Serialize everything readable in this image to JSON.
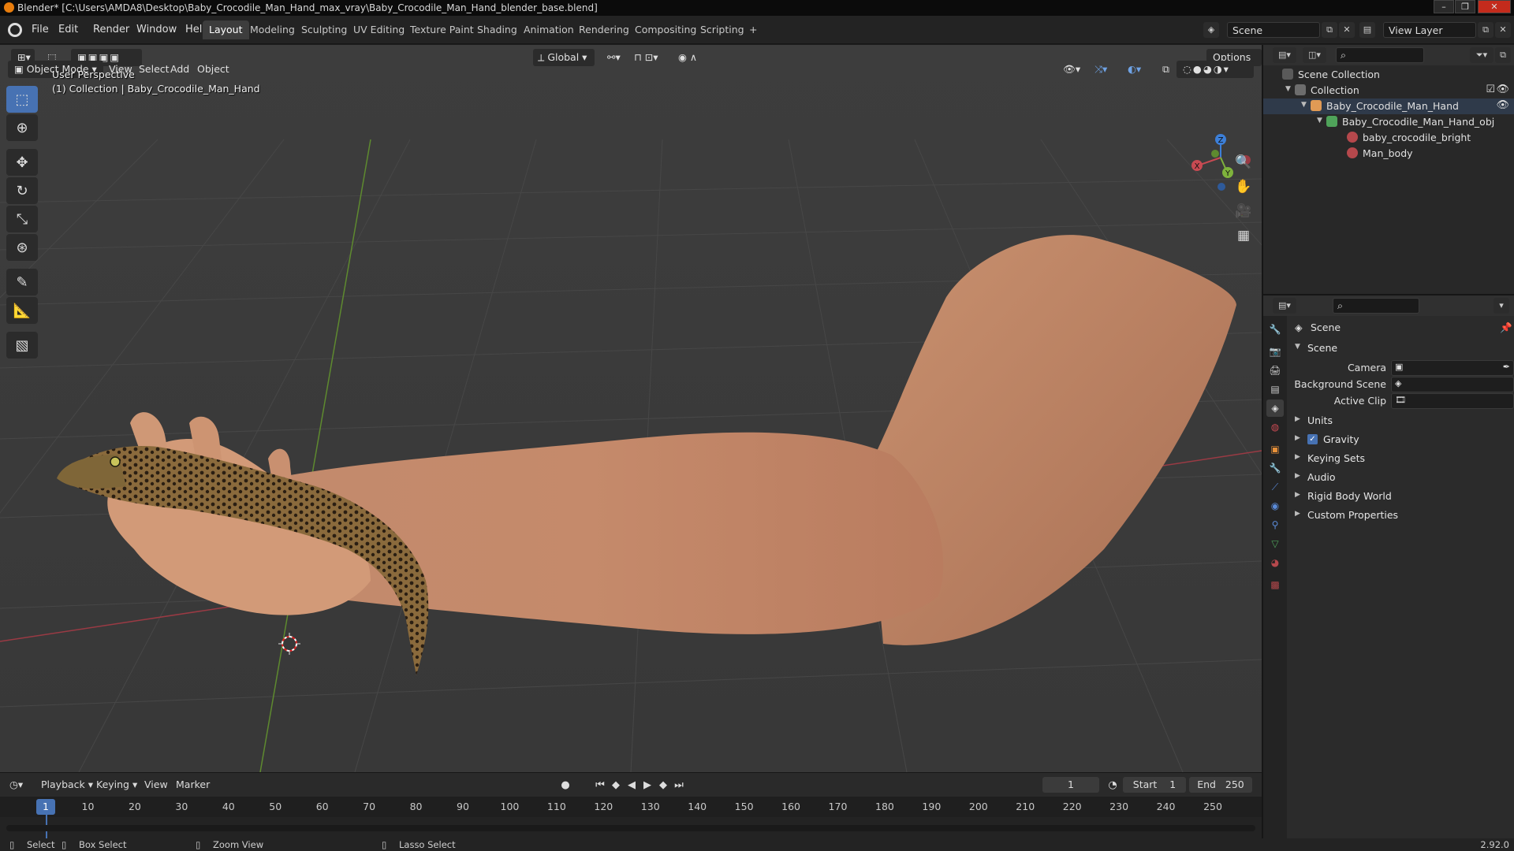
{
  "window": {
    "title": "Blender* [C:\\Users\\AMDA8\\Desktop\\Baby_Crocodile_Man_Hand_max_vray\\Baby_Crocodile_Man_Hand_blender_base.blend]"
  },
  "menubar": {
    "menus": [
      "File",
      "Edit",
      "Render",
      "Window",
      "Help"
    ],
    "workspaces": [
      "Layout",
      "Modeling",
      "Sculpting",
      "UV Editing",
      "Texture Paint",
      "Shading",
      "Animation",
      "Rendering",
      "Compositing",
      "Scripting"
    ],
    "active_workspace": "Layout",
    "add_workspace": "+",
    "scene": "Scene",
    "view_layer": "View Layer"
  },
  "viewport": {
    "mode": "Object Mode",
    "menus": [
      "View",
      "Select",
      "Add",
      "Object"
    ],
    "orientation": "Global",
    "options": "Options",
    "info_line1": "User Perspective",
    "info_line2": "(1) Collection | Baby_Crocodile_Man_Hand",
    "gizmo": {
      "x": "X",
      "y": "Y",
      "z": "Z"
    }
  },
  "outliner": {
    "root": "Scene Collection",
    "collection": "Collection",
    "object": "Baby_Crocodile_Man_Hand",
    "mesh": "Baby_Crocodile_Man_Hand_obj",
    "materials": [
      "baby_crocodile_bright",
      "Man_body"
    ]
  },
  "properties": {
    "context": "Scene",
    "panel": "Scene",
    "fields": [
      {
        "label": "Camera"
      },
      {
        "label": "Background Scene"
      },
      {
        "label": "Active Clip"
      }
    ],
    "subpanels": [
      "Units",
      "Gravity",
      "Keying Sets",
      "Audio",
      "Rigid Body World",
      "Custom Properties"
    ],
    "gravity_checked": true
  },
  "timeline": {
    "menus": [
      "Playback",
      "Keying",
      "View",
      "Marker"
    ],
    "current_frame": "1",
    "start_label": "Start",
    "start": "1",
    "end_label": "End",
    "end": "250",
    "ticks": [
      "1",
      "10",
      "20",
      "30",
      "40",
      "50",
      "60",
      "70",
      "80",
      "90",
      "100",
      "110",
      "120",
      "130",
      "140",
      "150",
      "160",
      "170",
      "180",
      "190",
      "200",
      "210",
      "220",
      "230",
      "240",
      "250"
    ]
  },
  "statusbar": {
    "select": "Select",
    "box_select": "Box Select",
    "zoom_view": "Zoom View",
    "lasso_select": "Lasso Select",
    "version": "2.92.0"
  },
  "colors": {
    "accent": "#4772b3",
    "x_axis": "#c84a52",
    "y_axis": "#7fb33c",
    "z_axis": "#3c7fd8",
    "skin": "#c98d6c"
  }
}
